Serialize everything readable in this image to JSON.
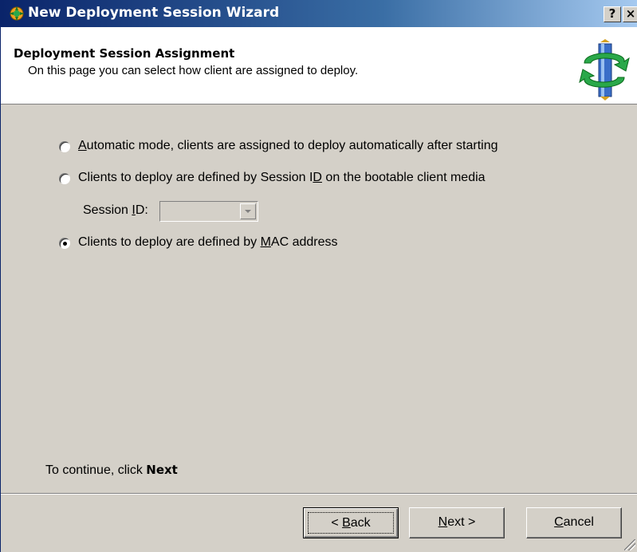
{
  "window": {
    "title": "New Deployment Session Wizard",
    "help_btn": "?",
    "close_btn": "×",
    "icon": "wizard-app-icon"
  },
  "header": {
    "title": "Deployment Session Assignment",
    "subtitle": "On this page you can select how client are assigned to deploy.",
    "logo_icon": "deployment-logo-icon"
  },
  "options": {
    "automatic": {
      "accel": "A",
      "rest": "utomatic mode, clients are assigned to deploy automatically after starting",
      "checked": false
    },
    "session_id": {
      "before": "Clients to deploy are defined by Session I",
      "accel": "D",
      "after": " on the bootable client media",
      "checked": false
    },
    "mac": {
      "before": "Clients to deploy are defined by ",
      "accel": "M",
      "after": "AC address",
      "checked": true
    }
  },
  "session_field": {
    "label_before": "Session ",
    "label_accel": "I",
    "label_after": "D:",
    "value": "",
    "enabled": false
  },
  "footer": {
    "continue_prefix": "To continue, click ",
    "continue_bold": "Next"
  },
  "buttons": {
    "back": {
      "prefix": "< ",
      "accel": "B",
      "rest": "ack"
    },
    "next": {
      "accel": "N",
      "rest": "ext >"
    },
    "cancel": {
      "accel": "C",
      "rest": "ancel"
    }
  },
  "colors": {
    "titlebar_start": "#0a246a",
    "titlebar_end": "#a6caf0",
    "dialog_face": "#d4d0c8",
    "header_bg": "#ffffff"
  }
}
